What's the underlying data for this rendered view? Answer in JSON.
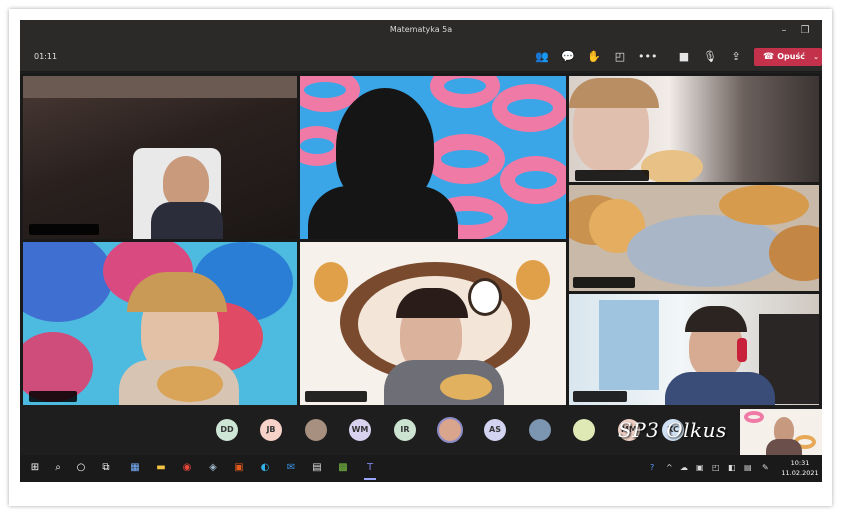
{
  "window": {
    "title": "Matematyka 5a"
  },
  "toolbar": {
    "timer": "01:11",
    "leave_label": "Opuść",
    "icons": [
      "participants-icon",
      "chat-icon",
      "raise-hand-icon",
      "breakout-rooms-icon",
      "more-options-icon",
      "camera-icon",
      "microphone-icon",
      "share-screen-icon"
    ]
  },
  "roster": {
    "avatars": [
      {
        "initials": "DD",
        "color": "#cde6d6"
      },
      {
        "initials": "JB",
        "color": "#f6d2c9"
      },
      {
        "initials": "",
        "color": "#a89080"
      },
      {
        "initials": "WM",
        "color": "#d9d2ee"
      },
      {
        "initials": "IR",
        "color": "#cbe3d0"
      },
      {
        "initials": "",
        "color": "#d9a58c"
      },
      {
        "initials": "AS",
        "color": "#d2d3f1"
      },
      {
        "initials": "",
        "color": "#7c95b0"
      },
      {
        "initials": "",
        "color": "#dfe9b6"
      },
      {
        "initials": "MM",
        "color": "#f1d1c6"
      },
      {
        "initials": "KC",
        "color": "#cfe1f3"
      }
    ]
  },
  "watermark": "SP3 Olkus",
  "taskbar": {
    "time": "10:31",
    "date": "11.02.2021"
  },
  "colors": {
    "leave": "#c4314b",
    "donut_pink": "#f07aa6",
    "donut_bg": "#3aa6e8"
  }
}
